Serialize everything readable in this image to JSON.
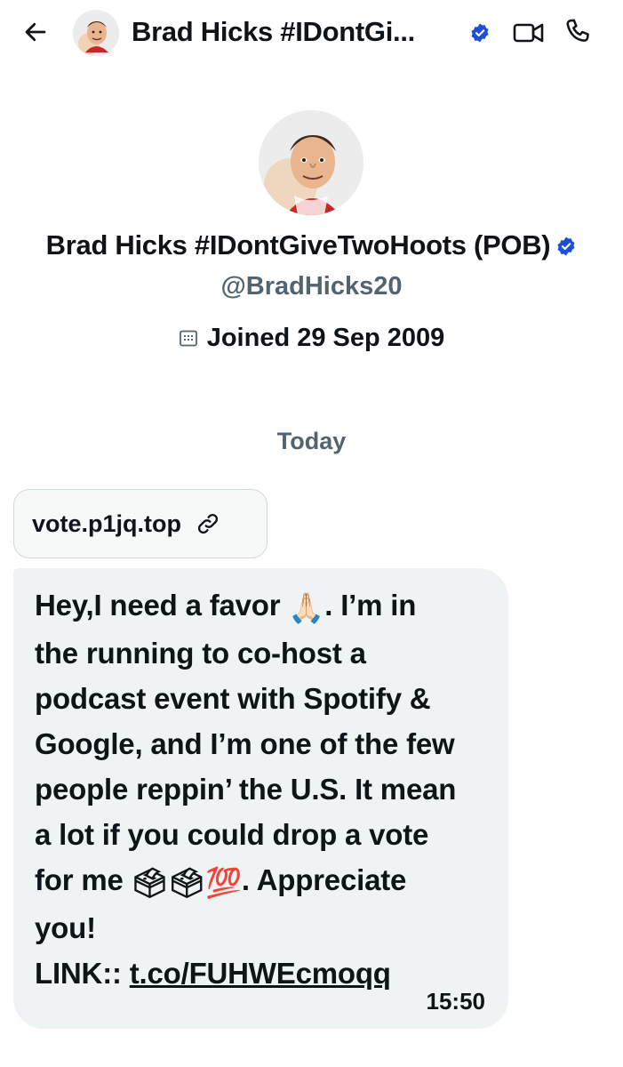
{
  "header": {
    "title": "Brad Hicks #IDontGi..."
  },
  "profile": {
    "name": "Brad Hicks #IDontGiveTwoHoots (POB)",
    "handle": "@BradHicks20",
    "joined": "Joined 29 Sep 2009"
  },
  "colors": {
    "verified_badge": "#1d4ed8",
    "secondary_text": "#536471",
    "bubble_bg": "#eff3f4",
    "chip_border": "#cfd9de"
  },
  "conversation": {
    "date_divider": "Today",
    "link_preview": {
      "text": "vote.p1jq.top",
      "icon": "link-icon"
    },
    "message": {
      "line1_a": "Hey,I need a favor ",
      "line1_b": ". I’m in",
      "line2": "the running to co-host a",
      "line3": "podcast event with Spotify &",
      "line4": "Google, and I’m one of the few",
      "line5": "people reppin’ the U.S. It mean",
      "line6": "a lot if you could drop a vote",
      "line7_a": "for me ",
      "line7_b": ". Appreciate",
      "line8": "you!",
      "link_label": "LINK:: ",
      "link_url": "t.co/FUHWEcmoqq",
      "emoji_pray": "🙏🏻",
      "emoji_ballots": "🗳🗳💯",
      "time": "15:50"
    }
  }
}
